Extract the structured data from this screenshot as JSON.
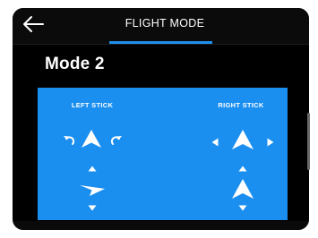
{
  "header": {
    "back_icon": "arrow-left-icon",
    "title": "FLIGHT MODE",
    "accent_color": "#1f8fef"
  },
  "mode": {
    "title": "Mode 2"
  },
  "panel": {
    "background_color": "#1a8ff0",
    "left_stick": {
      "label": "LEFT STICK",
      "icons": [
        "rotate-left-icon",
        "aircraft-up-icon",
        "rotate-right-icon",
        "arrow-up-small-icon",
        "aircraft-yaw-icon",
        "arrow-down-small-icon"
      ]
    },
    "right_stick": {
      "label": "RIGHT STICK",
      "icons": [
        "arrow-left-small-icon",
        "aircraft-up-icon",
        "arrow-right-small-icon",
        "arrow-up-small-icon",
        "aircraft-up-icon",
        "arrow-down-small-icon"
      ]
    }
  }
}
